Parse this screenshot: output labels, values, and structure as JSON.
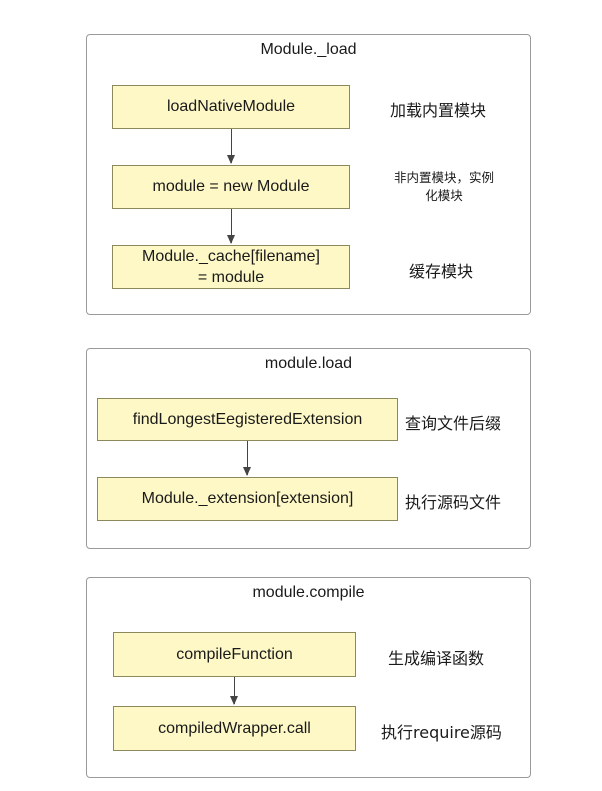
{
  "groups": [
    {
      "title": "Module._load",
      "nodes": [
        "loadNativeModule",
        "module = new Module",
        "Module._cache[filename]\n= module"
      ],
      "notes": [
        "加载内置模块",
        "非内置模块，实例\n化模块",
        "缓存模块"
      ]
    },
    {
      "title": "module.load",
      "nodes": [
        "findLongestEegisteredExtension",
        "Module._extension[extension]"
      ],
      "notes": [
        "查询文件后缀",
        "执行源码文件"
      ]
    },
    {
      "title": "module.compile",
      "nodes": [
        "compileFunction",
        "compiledWrapper.call"
      ],
      "notes": [
        "生成编译函数",
        "执行require源码"
      ]
    }
  ],
  "colors": {
    "node_fill": "#fdf8c6",
    "node_border": "#8c8a5c",
    "frame_border": "#9a9a9a",
    "arrow": "#444444"
  }
}
